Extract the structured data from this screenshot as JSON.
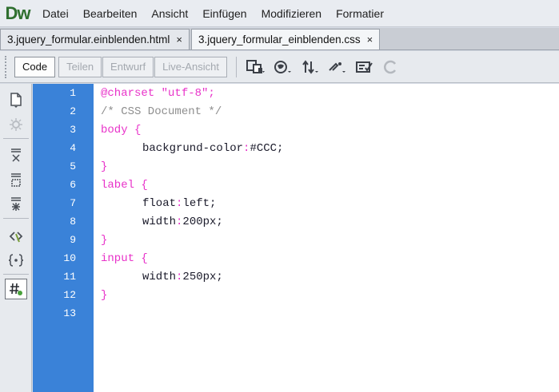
{
  "app": {
    "logo": "Dw"
  },
  "menu": [
    "Datei",
    "Bearbeiten",
    "Ansicht",
    "Einfügen",
    "Modifizieren",
    "Formatier"
  ],
  "tabs": [
    {
      "label": "3.jquery_formular.einblenden.html",
      "close": "×",
      "active": false
    },
    {
      "label": "3.jquery_formular_einblenden.css",
      "close": "×",
      "active": true
    }
  ],
  "toolbar": {
    "code_label": "Code",
    "split_label": "Teilen",
    "design_label": "Entwurf",
    "live_label": "Live-Ansicht"
  },
  "gutter": {
    "lines": [
      "1",
      "2",
      "3",
      "4",
      "5",
      "6",
      "7",
      "8",
      "9",
      "10",
      "11",
      "12",
      "13"
    ]
  },
  "code": {
    "l1": {
      "a": "@charset ",
      "b": "\"utf-8\";"
    },
    "l2": "/* CSS Document */",
    "l3": "body {",
    "l4": {
      "prop": "backgrund-color",
      "colon": ":",
      "val": "#CCC;"
    },
    "l5": "}",
    "l6": "label {",
    "l7": {
      "prop": "float",
      "colon": ":",
      "val": "left;"
    },
    "l8": {
      "prop": "width",
      "colon": ":",
      "val": "200px;"
    },
    "l9": "}",
    "l10": "input {",
    "l11": {
      "prop": "width",
      "colon": ":",
      "val": "250px;"
    },
    "l12": "}"
  },
  "colors": {
    "gutter": "#3a82d8",
    "keyword": "#e832c9",
    "comment": "#8e8e8e",
    "logo": "#2f6f2f"
  }
}
